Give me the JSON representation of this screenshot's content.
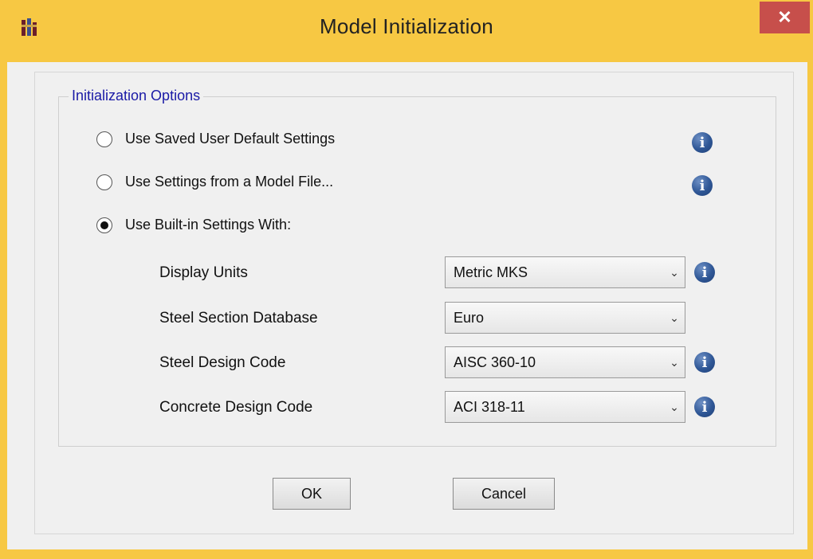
{
  "window": {
    "title": "Model Initialization",
    "close_glyph": "✕"
  },
  "group": {
    "legend": "Initialization Options"
  },
  "options": [
    {
      "label": "Use Saved User Default Settings",
      "checked": false
    },
    {
      "label": "Use Settings from a Model File...",
      "checked": false
    },
    {
      "label": "Use Built-in Settings With:",
      "checked": true
    }
  ],
  "fields": [
    {
      "label": "Display Units",
      "value": "Metric MKS",
      "has_info": true
    },
    {
      "label": "Steel Section Database",
      "value": "Euro",
      "has_info": false
    },
    {
      "label": "Steel Design Code",
      "value": "AISC 360-10",
      "has_info": true
    },
    {
      "label": "Concrete Design Code",
      "value": "ACI 318-11",
      "has_info": true
    }
  ],
  "buttons": {
    "ok": "OK",
    "cancel": "Cancel"
  },
  "icons": {
    "info": "i",
    "chevron": "⌄"
  },
  "colors": {
    "frame": "#f7c843",
    "close": "#c74f4b",
    "legend_text": "#1a1aa6",
    "info_blue": "#2f5796"
  }
}
